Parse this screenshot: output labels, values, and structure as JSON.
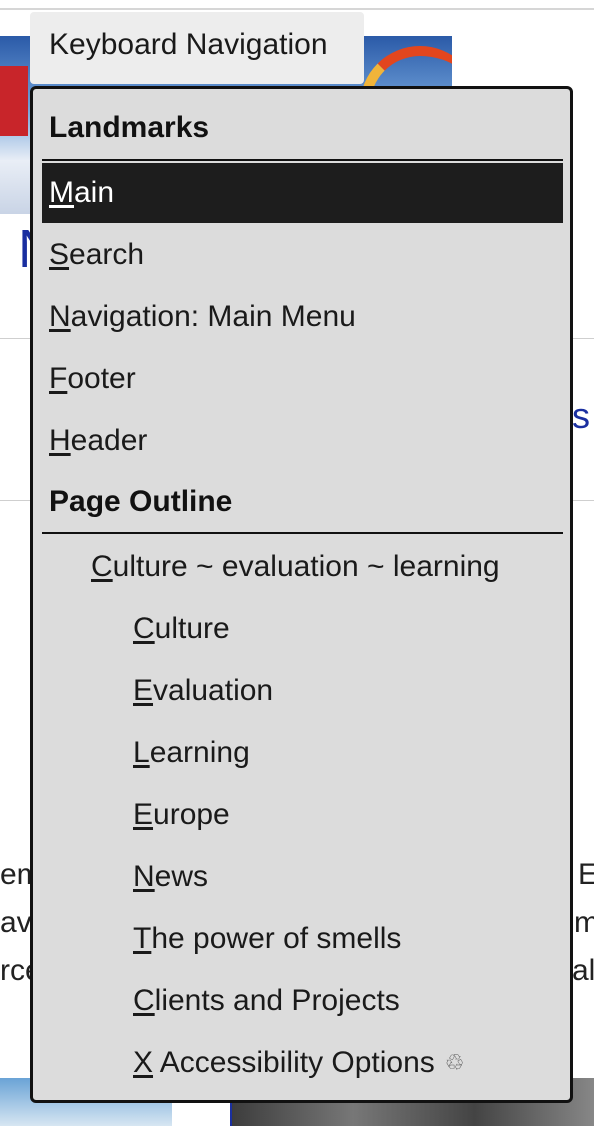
{
  "keyboard_navigation": {
    "tab_label": "Keyboard Navigation",
    "landmarks_heading": "Landmarks",
    "landmarks": [
      {
        "first": "M",
        "rest": "ain",
        "active": true
      },
      {
        "first": "S",
        "rest": "earch",
        "active": false
      },
      {
        "first": "N",
        "rest": "avigation: Main Menu",
        "active": false
      },
      {
        "first": "F",
        "rest": "ooter",
        "active": false
      },
      {
        "first": "H",
        "rest": "eader",
        "active": false
      }
    ],
    "outline_heading": "Page Outline",
    "outline": [
      {
        "first": "C",
        "rest": "ulture ~ evaluation ~ learning",
        "level": 1
      },
      {
        "first": "C",
        "rest": "ulture",
        "level": 2
      },
      {
        "first": "E",
        "rest": "valuation",
        "level": 2
      },
      {
        "first": "L",
        "rest": "earning",
        "level": 2
      },
      {
        "first": "E",
        "rest": "urope",
        "level": 2
      },
      {
        "first": "N",
        "rest": "ews",
        "level": 2
      },
      {
        "first": "T",
        "rest": "he power of smells",
        "level": 2
      },
      {
        "first": "C",
        "rest": "lients and Projects",
        "level": 2
      }
    ],
    "accessibility_option": {
      "first": "X",
      "rest": " Accessibility Options",
      "icon": "recycle-icon"
    }
  },
  "background": {
    "heading_fragment": "N",
    "link_fragment": "s",
    "text_left": [
      "em",
      "av",
      "rce"
    ],
    "text_right": [
      "E",
      "m",
      "al"
    ]
  }
}
